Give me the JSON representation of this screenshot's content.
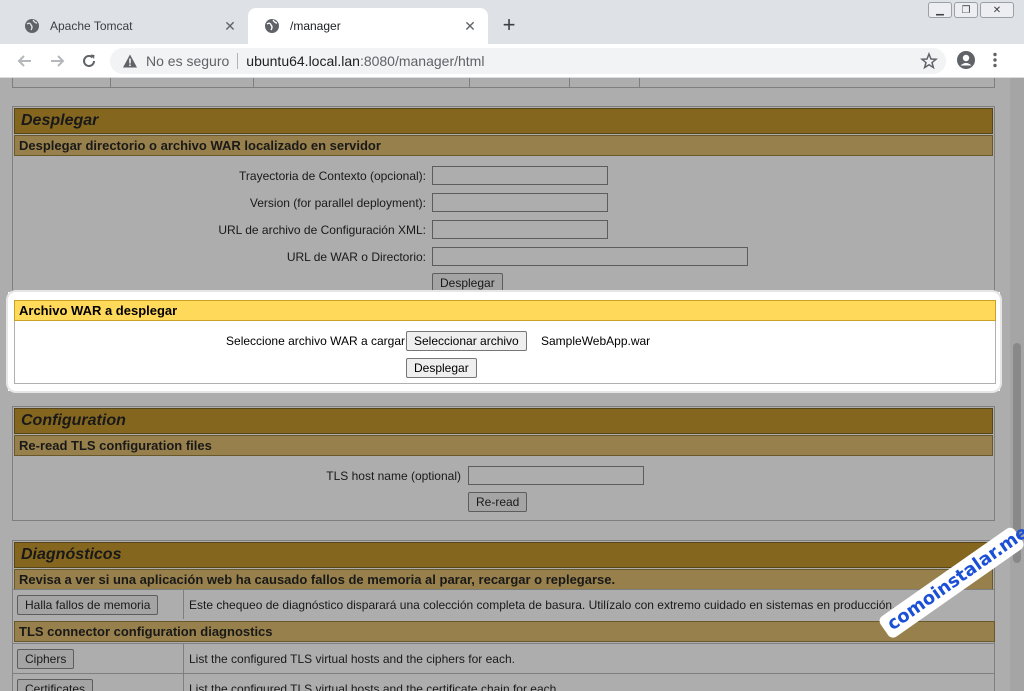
{
  "browser": {
    "tabs": [
      {
        "title": "Apache Tomcat",
        "active": false
      },
      {
        "title": "/manager",
        "active": true
      }
    ],
    "security_text": "No es seguro",
    "url_host": "ubuntu64.local.lan",
    "url_rest": ":8080/manager/html"
  },
  "deploy": {
    "title": "Desplegar",
    "subtitle": "Desplegar directorio o archivo WAR localizado en servidor",
    "context_label": "Trayectoria de Contexto (opcional):",
    "version_label": "Version (for parallel deployment):",
    "xml_label": "URL de archivo de Configuración XML:",
    "war_url_label": "URL de WAR o Directorio:",
    "deploy_button": "Desplegar"
  },
  "war_upload": {
    "title": "Archivo WAR a desplegar",
    "select_label": "Seleccione archivo WAR a cargar",
    "choose_button": "Seleccionar archivo",
    "file_name": "SampleWebApp.war",
    "deploy_button": "Desplegar"
  },
  "configuration": {
    "title": "Configuration",
    "subtitle": "Re-read TLS configuration files",
    "host_label": "TLS host name (optional)",
    "reread_button": "Re-read"
  },
  "diagnostics": {
    "title": "Diagnósticos",
    "subtitle": "Revisa a ver si una aplicación web ha causado fallos de memoria al parar, recargar o replegarse.",
    "leaks_button": "Halla fallos de memoria",
    "leaks_desc": "Este chequeo de diagnóstico disparará una colección completa de basura. Utilízalo con extremo cuidado en sistemas en producción.",
    "tls_subtitle": "TLS connector configuration diagnostics",
    "ciphers_button": "Ciphers",
    "ciphers_desc": "List the configured TLS virtual hosts and the ciphers for each.",
    "certs_button": "Certificates",
    "certs_desc": "List the configured TLS virtual hosts and the certificate chain for each."
  },
  "watermark": "comoinstalar.me"
}
